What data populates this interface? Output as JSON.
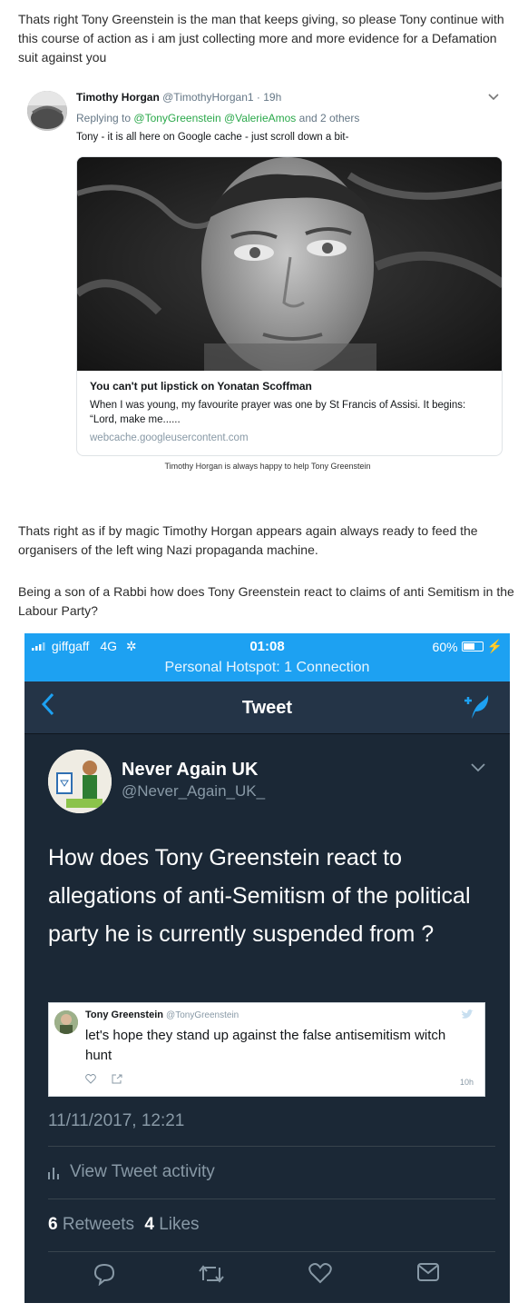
{
  "intro": {
    "lines": [
      "Thats right Tony Greenstein is the man that keeps giving, so please Tony continue with",
      "this course of action as i am just collecting more and more evidence for a Defamation",
      "suit against you"
    ]
  },
  "tweet1": {
    "name": "Timothy Horgan",
    "handle": "@TimothyHorgan1",
    "time": "· 19h",
    "replying_prefix": "Replying to",
    "replying_to_1": "@TonyGreenstein",
    "replying_to_2": "@ValerieAmos",
    "replying_suffix": "and 2 others",
    "text": "Tony - it is all here on Google cache - just scroll down a bit-",
    "card": {
      "title": "You can't put lipstick on Yonatan Scoffman",
      "description": "When I was young, my favourite prayer was one by St Francis of Assisi. It begins: “Lord, make me......",
      "domain": "webcache.googleusercontent.com"
    }
  },
  "caption": "Timothy Horgan is always happy to help Tony Greenstein",
  "para2": {
    "lines": [
      "Thats right as if by magic Timothy Horgan appears again always ready to feed the",
      "organisers of the left wing Nazi propaganda machine."
    ]
  },
  "para3": {
    "lines": [
      "Being a son of a Rabbi how does Tony Greenstein react to claims of anti Semitism in the",
      "Labour Party?"
    ]
  },
  "phone": {
    "status": {
      "carrier": "giffgaff",
      "network": "4G",
      "time": "01:08",
      "battery": "60%",
      "battery_level": 0.6,
      "hotspot": "Personal Hotspot: 1 Connection"
    },
    "nav": {
      "title": "Tweet"
    },
    "author": {
      "name": "Never Again UK",
      "handle": "@Never_Again_UK_"
    },
    "text": "How does Tony Greenstein react to allegations of anti-Semitism of the political party he is currently suspended from ?",
    "quoted": {
      "name": "Tony Greenstein",
      "handle": "@TonyGreenstein",
      "text": "let's hope they stand up against the false antisemitism witch hunt",
      "time": "10h"
    },
    "datetime": "11/11/2017, 12:21",
    "activity_label": "View Tweet activity",
    "retweets_count": "6",
    "retweets_label": "Retweets",
    "likes_count": "4",
    "likes_label": "Likes"
  },
  "colors": {
    "twitter_blue": "#1da1f2",
    "dark_bg": "#1b2836",
    "link_green": "#2aa84a"
  }
}
